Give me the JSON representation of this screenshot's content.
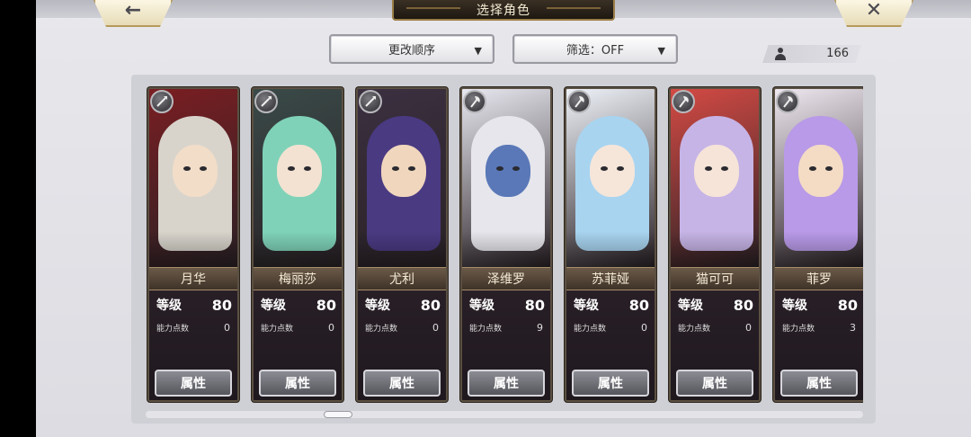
{
  "header": {
    "title": "选择角色",
    "back_icon": "←",
    "close_icon": "✕"
  },
  "controls": {
    "sort_label": "更改顺序",
    "filter_label": "筛选：OFF",
    "dropdown_arrow": "▼",
    "character_count": "166"
  },
  "cards": [
    {
      "name": "月华",
      "level_label": "等级",
      "level": "80",
      "ap_label": "能力点数",
      "ap": "0",
      "attr_label": "属性",
      "weapon": "spear-icon",
      "hair": "#d8d4cc",
      "skin": "#f1ddc8",
      "bg": "#7a1e22"
    },
    {
      "name": "梅丽莎",
      "level_label": "等级",
      "level": "80",
      "ap_label": "能力点数",
      "ap": "0",
      "attr_label": "属性",
      "weapon": "spear-icon",
      "hair": "#7fd2b8",
      "skin": "#f3e2d2",
      "bg": "#3a4a48"
    },
    {
      "name": "尤利",
      "level_label": "等级",
      "level": "80",
      "ap_label": "能力点数",
      "ap": "0",
      "attr_label": "属性",
      "weapon": "spear-icon",
      "hair": "#4a3a82",
      "skin": "#f0d6bc",
      "bg": "#3b3040"
    },
    {
      "name": "泽维罗",
      "level_label": "等级",
      "level": "80",
      "ap_label": "能力点数",
      "ap": "9",
      "attr_label": "属性",
      "weapon": "axe-icon",
      "hair": "#e6e6ec",
      "skin": "#5a78b8",
      "bg": "#e8e8f0"
    },
    {
      "name": "苏菲娅",
      "level_label": "等级",
      "level": "80",
      "ap_label": "能力点数",
      "ap": "0",
      "attr_label": "属性",
      "weapon": "axe-icon",
      "hair": "#a8d4f0",
      "skin": "#f6e6da",
      "bg": "#eef2f8"
    },
    {
      "name": "猫可可",
      "level_label": "等级",
      "level": "80",
      "ap_label": "能力点数",
      "ap": "0",
      "attr_label": "属性",
      "weapon": "axe-icon",
      "hair": "#c6b4e6",
      "skin": "#f6e4d8",
      "bg": "#d44a44"
    },
    {
      "name": "菲罗",
      "level_label": "等级",
      "level": "80",
      "ap_label": "能力点数",
      "ap": "3",
      "attr_label": "属性",
      "weapon": "axe-icon",
      "hair": "#b89ae8",
      "skin": "#f4dcc4",
      "bg": "#efe8f0"
    }
  ]
}
